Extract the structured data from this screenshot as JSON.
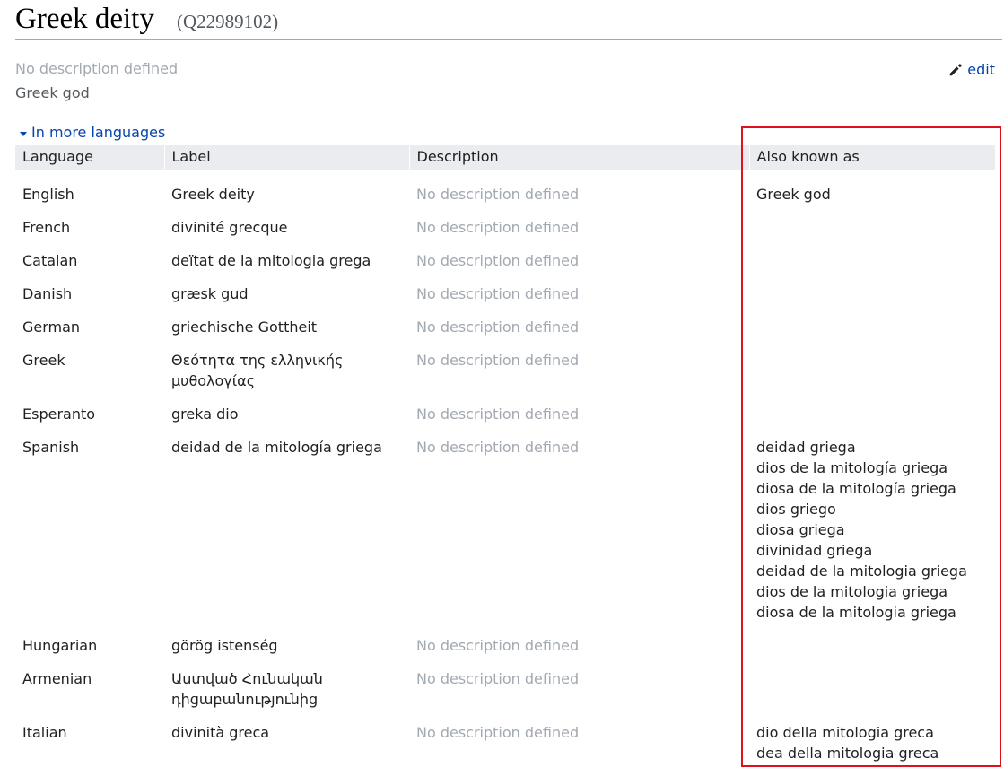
{
  "header": {
    "title": "Greek deity",
    "id": "(Q22989102)"
  },
  "summary": {
    "description": "No description defined",
    "alias": "Greek god",
    "edit_label": "edit"
  },
  "languages": {
    "toggle_label": "In more languages",
    "columns": [
      "Language",
      "Label",
      "Description",
      "Also known as"
    ],
    "rows": [
      {
        "language": "English",
        "label": "Greek deity",
        "description": "No description defined",
        "aliases": [
          "Greek god"
        ]
      },
      {
        "language": "French",
        "label": "divinité grecque",
        "description": "No description defined",
        "aliases": []
      },
      {
        "language": "Catalan",
        "label": "deïtat de la mitologia grega",
        "description": "No description defined",
        "aliases": []
      },
      {
        "language": "Danish",
        "label": "græsk gud",
        "description": "No description defined",
        "aliases": []
      },
      {
        "language": "German",
        "label": "griechische Gottheit",
        "description": "No description defined",
        "aliases": []
      },
      {
        "language": "Greek",
        "label": "Θεότητα της ελληνικής μυθολογίας",
        "description": "No description defined",
        "aliases": []
      },
      {
        "language": "Esperanto",
        "label": "greka dio",
        "description": "No description defined",
        "aliases": []
      },
      {
        "language": "Spanish",
        "label": "deidad de la mitología griega",
        "description": "No description defined",
        "aliases": [
          "deidad griega",
          "dios de la mitología griega",
          "diosa de la mitología griega",
          "dios griego",
          "diosa griega",
          "divinidad griega",
          "deidad de la mitologia griega",
          "dios de la mitologia griega",
          "diosa de la mitologia griega"
        ]
      },
      {
        "language": "Hungarian",
        "label": "görög istenség",
        "description": "No description defined",
        "aliases": []
      },
      {
        "language": "Armenian",
        "label": "Աստված Հունական դիցաբանությունից",
        "description": "No description defined",
        "aliases": []
      },
      {
        "language": "Italian",
        "label": "divinità greca",
        "description": "No description defined",
        "aliases": [
          "dio della mitologia greca",
          "dea della mitologia greca"
        ]
      }
    ]
  },
  "colors": {
    "link": "#0645ad",
    "muted": "#a2a9b1",
    "header_bg": "#eaecf0",
    "highlight": "#e0101c"
  }
}
